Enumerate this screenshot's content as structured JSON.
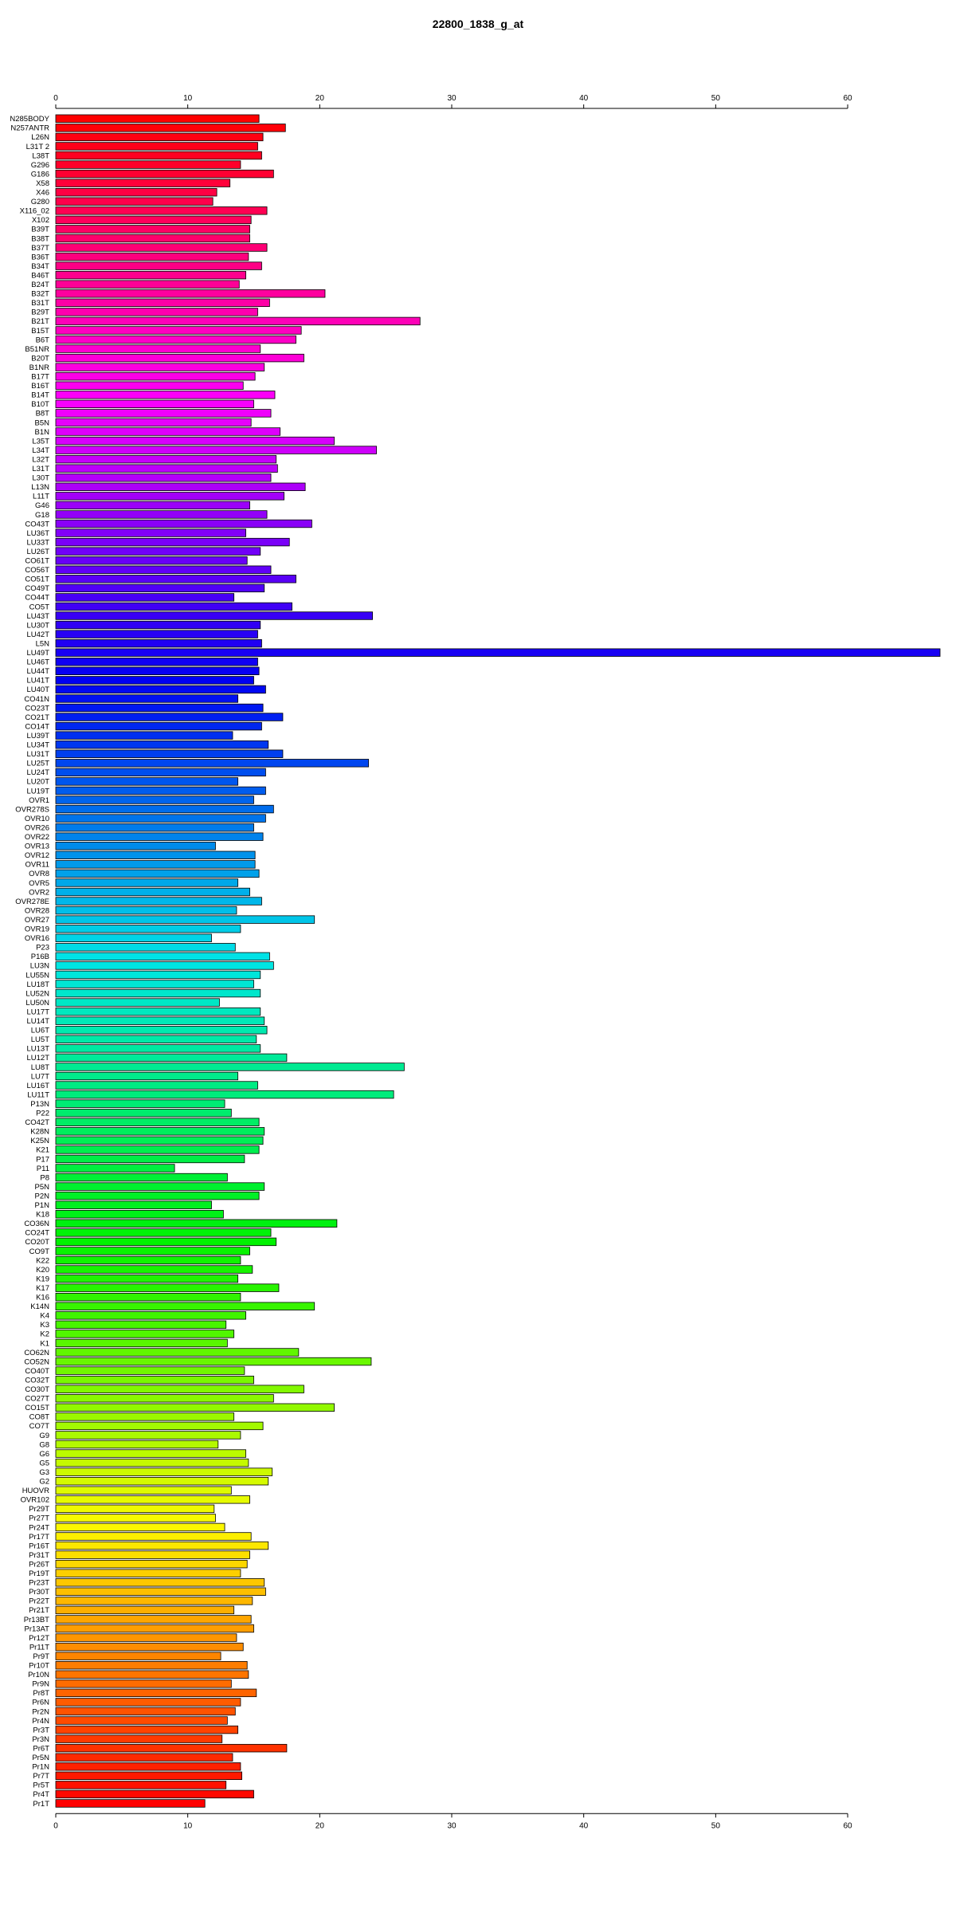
{
  "chart_data": {
    "type": "bar",
    "orientation": "horizontal",
    "title": "22800_1838_g_at",
    "xlabel": "",
    "ylabel": "",
    "xlim": [
      0,
      67
    ],
    "xticks": [
      0,
      10,
      20,
      30,
      40,
      50,
      60
    ],
    "grid": false,
    "legend": "none",
    "bar_colors": "rainbow gradient from red (top) through magenta, blue, cyan, green, yellow, orange back to red (bottom)",
    "categories": [
      "N285BODY",
      "N257ANTR",
      "L26N",
      "L31T 2",
      "L38T",
      "G296",
      "G186",
      "X58",
      "X46",
      "G280",
      "X116_02",
      "X102",
      "B39T",
      "B38T",
      "B37T",
      "B36T",
      "B34T",
      "B46T",
      "B24T",
      "B32T",
      "B31T",
      "B29T",
      "B21T",
      "B15T",
      "B6T",
      "B51NR",
      "B20T",
      "B1NR",
      "B17T",
      "B16T",
      "B14T",
      "B10T",
      "B8T",
      "B5N",
      "B1N",
      "L35T",
      "L34T",
      "L32T",
      "L31T",
      "L30T",
      "L13N",
      "L11T",
      "G46",
      "G18",
      "CO43T",
      "LU36T",
      "LU33T",
      "LU26T",
      "CO61T",
      "CO56T",
      "CO51T",
      "CO49T",
      "CO44T",
      "CO5T",
      "LU43T",
      "LU30T",
      "LU42T",
      "L5N",
      "LU49T",
      "LU46T",
      "LU44T",
      "LU41T",
      "LU40T",
      "CO41N",
      "CO23T",
      "CO21T",
      "CO14T",
      "LU39T",
      "LU34T",
      "LU31T",
      "LU25T",
      "LU24T",
      "LU20T",
      "LU19T",
      "OVR1",
      "OVR278S",
      "OVR10",
      "OVR26",
      "OVR22",
      "OVR13",
      "OVR12",
      "OVR11",
      "OVR8",
      "OVR5",
      "OVR2",
      "OVR278E",
      "OVR28",
      "OVR27",
      "OVR19",
      "OVR16",
      "P23",
      "P16B",
      "LU3N",
      "LU55N",
      "LU18T",
      "LU52N",
      "LU50N",
      "LU17T",
      "LU14T",
      "LU6T",
      "LU5T",
      "LU13T",
      "LU12T",
      "LU8T",
      "LU7T",
      "LU16T",
      "LU11T",
      "P13N",
      "P22",
      "CO42T",
      "K28N",
      "K25N",
      "K21",
      "P17",
      "P11",
      "P8",
      "P5N",
      "P2N",
      "P1N",
      "K18",
      "CO36N",
      "CO24T",
      "CO20T",
      "CO9T",
      "K22",
      "K20",
      "K19",
      "K17",
      "K16",
      "K14N",
      "K4",
      "K3",
      "K2",
      "K1",
      "CO62N",
      "CO52N",
      "CO40T",
      "CO32T",
      "CO30T",
      "CO27T",
      "CO15T",
      "CO8T",
      "CO7T",
      "G9",
      "G8",
      "G6",
      "G5",
      "G3",
      "G2",
      "HUOVR",
      "OVR102",
      "Pr29T",
      "Pr27T",
      "Pr24T",
      "Pr17T",
      "Pr16T",
      "Pr31T",
      "Pr26T",
      "Pr19T",
      "Pr23T",
      "Pr30T",
      "Pr22T",
      "Pr21T",
      "Pr13BT",
      "Pr13AT",
      "Pr12T",
      "Pr11T",
      "Pr9T",
      "Pr10T",
      "Pr10N",
      "Pr9N",
      "Pr8T",
      "Pr6N",
      "Pr2N",
      "Pr4N",
      "Pr3T",
      "Pr3N",
      "Pr6T",
      "Pr5N",
      "Pr1N",
      "Pr7T",
      "Pr5T",
      "Pr4T",
      "Pr1T"
    ],
    "values": [
      15.4,
      17.4,
      15.7,
      15.3,
      15.6,
      14.0,
      16.5,
      13.2,
      12.2,
      11.9,
      16.0,
      14.8,
      14.7,
      14.7,
      16.0,
      14.6,
      15.6,
      14.4,
      13.9,
      20.4,
      16.2,
      15.3,
      27.6,
      18.6,
      18.2,
      15.5,
      18.8,
      15.8,
      15.1,
      14.2,
      16.6,
      15.0,
      16.3,
      14.8,
      17.0,
      21.1,
      24.3,
      16.7,
      16.8,
      16.3,
      18.9,
      17.3,
      14.7,
      16.0,
      19.4,
      14.4,
      17.7,
      15.5,
      14.5,
      16.3,
      18.2,
      15.8,
      13.5,
      17.9,
      24.0,
      15.5,
      15.3,
      15.6,
      67.0,
      15.3,
      15.4,
      15.0,
      15.9,
      13.8,
      15.7,
      17.2,
      15.6,
      13.4,
      16.1,
      17.2,
      23.7,
      15.9,
      13.8,
      15.9,
      15.0,
      16.5,
      15.9,
      15.0,
      15.7,
      12.1,
      15.1,
      15.1,
      15.4,
      13.8,
      14.7,
      15.6,
      13.7,
      19.6,
      14.0,
      11.8,
      13.6,
      16.2,
      16.5,
      15.5,
      15.0,
      15.5,
      12.4,
      15.5,
      15.8,
      16.0,
      15.2,
      15.5,
      17.5,
      26.4,
      13.8,
      15.3,
      25.6,
      12.8,
      13.3,
      15.4,
      15.8,
      15.7,
      15.4,
      14.3,
      9.0,
      13.0,
      15.8,
      15.4,
      11.8,
      12.7,
      21.3,
      16.3,
      16.7,
      14.7,
      14.0,
      14.9,
      13.8,
      16.9,
      14.0,
      19.6,
      14.4,
      12.9,
      13.5,
      13.0,
      18.4,
      23.9,
      14.3,
      15.0,
      18.8,
      16.5,
      21.1,
      13.5,
      15.7,
      14.0,
      12.3,
      14.4,
      14.6,
      16.4,
      16.1,
      13.3,
      14.7,
      12.0,
      12.1,
      12.8,
      14.8,
      16.1,
      14.7,
      14.5,
      14.0,
      15.8,
      15.9,
      14.9,
      13.5,
      14.8,
      15.0,
      13.7,
      14.2,
      12.5,
      14.5,
      14.6,
      13.3,
      15.2,
      14.0,
      13.6,
      13.0,
      13.8,
      12.6,
      17.5,
      13.4,
      14.0,
      14.1,
      12.9,
      15.0,
      11.3
    ]
  }
}
